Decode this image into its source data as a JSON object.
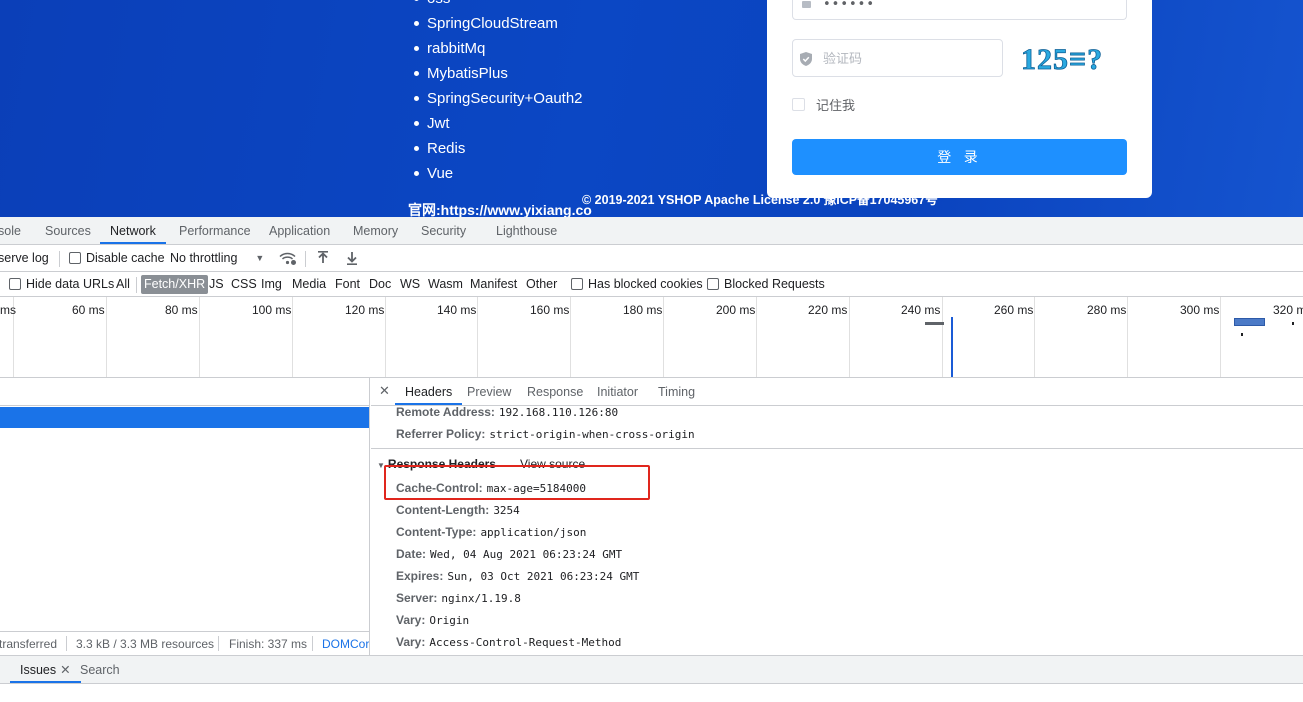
{
  "page": {
    "tech_list": [
      "oss",
      "SpringCloudStream",
      "rabbitMq",
      "MybatisPlus",
      "SpringSecurity+Oauth2",
      "Jwt",
      "Redis",
      "Vue"
    ],
    "footer_line1": "© 2019-2021 YSHOP Apache License 2.0  豫ICP备17045967号",
    "footer_line2": "官网:https://www.yixiang.co"
  },
  "login": {
    "password_mask": "••••••",
    "captcha_placeholder": "验证码",
    "captcha_text": "125≡?",
    "remember_label": "记住我",
    "login_button": "登 录"
  },
  "devtools": {
    "tabs": [
      "sole",
      "Sources",
      "Network",
      "Performance",
      "Application",
      "Memory",
      "Security",
      "Lighthouse"
    ],
    "active_tab": "Network",
    "toolbar1": {
      "preserve_log": "serve log",
      "disable_cache": "Disable cache",
      "throttling": "No throttling"
    },
    "toolbar2": {
      "hide_data_urls": "Hide data URLs",
      "types": [
        "All",
        "Fetch/XHR",
        "JS",
        "CSS",
        "Img",
        "Media",
        "Font",
        "Doc",
        "WS",
        "Wasm",
        "Manifest",
        "Other"
      ],
      "active_type": "Fetch/XHR",
      "has_blocked_cookies": "Has blocked cookies",
      "blocked_requests": "Blocked Requests"
    },
    "timeline_labels": [
      "ms",
      "60 ms",
      "80 ms",
      "100 ms",
      "120 ms",
      "140 ms",
      "160 ms",
      "180 ms",
      "200 ms",
      "220 ms",
      "240 ms",
      "260 ms",
      "280 ms",
      "300 ms",
      "320 m"
    ],
    "status": {
      "transferred": "transferred",
      "resources": "3.3 kB / 3.3 MB resources",
      "finish": "Finish: 337 ms",
      "domcontent": "DOMCor"
    },
    "detail_tabs": [
      "Headers",
      "Preview",
      "Response",
      "Initiator",
      "Timing"
    ],
    "active_detail_tab": "Headers",
    "general": [
      {
        "k": "Remote Address:",
        "v": "192.168.110.126:80"
      },
      {
        "k": "Referrer Policy:",
        "v": "strict-origin-when-cross-origin"
      }
    ],
    "response_headers_title": "Response Headers",
    "view_source": "View source",
    "response_headers": [
      {
        "k": "Cache-Control:",
        "v": "max-age=5184000"
      },
      {
        "k": "Content-Length:",
        "v": "3254"
      },
      {
        "k": "Content-Type:",
        "v": "application/json"
      },
      {
        "k": "Date:",
        "v": "Wed, 04 Aug 2021 06:23:24 GMT"
      },
      {
        "k": "Expires:",
        "v": "Sun, 03 Oct 2021 06:23:24 GMT"
      },
      {
        "k": "Server:",
        "v": "nginx/1.19.8"
      },
      {
        "k": "Vary:",
        "v": "Origin"
      },
      {
        "k": "Vary:",
        "v": "Access-Control-Request-Method"
      }
    ],
    "drawer_tabs": [
      "Issues",
      "Search"
    ],
    "active_drawer_tab": "Issues"
  },
  "colors": {
    "page_blue": "#0b47c4",
    "login_button": "#1e90ff",
    "devtools_accent": "#1a73e8",
    "highlight_red": "#e0261d"
  }
}
